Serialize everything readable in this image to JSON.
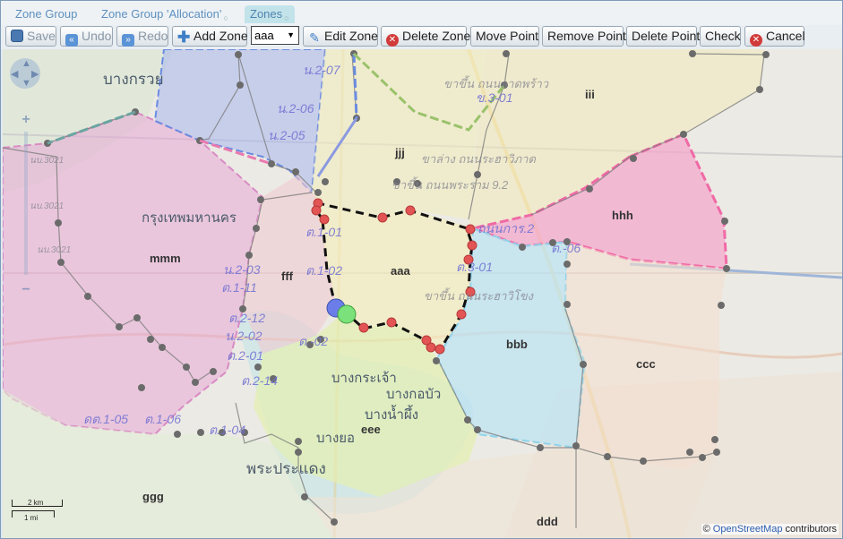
{
  "tabs": [
    {
      "label": "Zone Group"
    },
    {
      "label": "Zone Group 'Allocation'",
      "close": "○"
    },
    {
      "label": "Zones",
      "close": "○"
    }
  ],
  "toolbar": {
    "save": "Save",
    "undo": "Undo",
    "redo": "Redo",
    "add_zone": "Add Zone",
    "zone_select": "aaa",
    "edit_zone": "Edit Zone",
    "delete_zone": "Delete Zone",
    "move_point": "Move Point",
    "remove_point": "Remove Point",
    "delete_point": "Delete Point",
    "check": "Check",
    "cancel": "Cancel"
  },
  "icons": {
    "save": "save-icon",
    "undo": "undo-icon",
    "redo": "redo-icon",
    "add": "plus-icon",
    "edit": "pencil-icon",
    "delete": "delete-icon",
    "cancel": "cancel-icon"
  },
  "colors": {
    "zone_pink": "#e97ab0",
    "zone_hot_pink": "#f06aa6",
    "zone_blue": "#7c93e0",
    "zone_yellow": "#e2e27a",
    "zone_cyan": "#8fd3ea",
    "zone_green": "#b9de8a",
    "edit_line": "#111111",
    "vertex": "#e35454",
    "start_point": "#6a7de8",
    "end_point": "#7be27b",
    "border_point": "#555555"
  },
  "map": {
    "zones": [
      "jjj",
      "hhh",
      "iii",
      "mmm",
      "fff",
      "aaa",
      "bbb",
      "ccc",
      "eee",
      "ggg",
      "ddd"
    ],
    "place_labels": [
      "บางกรวย",
      "กรุงเทพมหานคร",
      "บางกระเจ้า",
      "บางกอบัว",
      "บางน้ำผึ้ง",
      "บางยอ",
      "พระประแดง"
    ],
    "road_labels": [
      "น.2-07",
      "น.2-06",
      "น.2-05",
      "ข.3-01",
      "ขาขึ้น ถนนลาดพร้าว",
      "ขาล่าง ถนนระฮาวิภาต",
      "ขาขึ้น ถนนพระราม 9.2",
      "ต.1-01",
      "ต.1-02",
      "ถนนการ.2",
      "ต.3-01",
      "ขาขึ้น ถนนระฮาวิโขง",
      "ต.-06",
      "น.2-03",
      "ต.1-11",
      "ต.2-12",
      "น.2-02",
      "ต.2-01",
      "ต.2-14",
      "ต.-02",
      "ดต.1-05",
      "ต.1-06",
      "ต.1-04",
      "นบ.3021",
      "นบ.3021",
      "นบ.3021"
    ],
    "scale_km": "2 km",
    "scale_mi": "1 mi",
    "attribution": {
      "prefix": "©",
      "link": "OpenStreetMap",
      "suffix": "contributors"
    }
  }
}
